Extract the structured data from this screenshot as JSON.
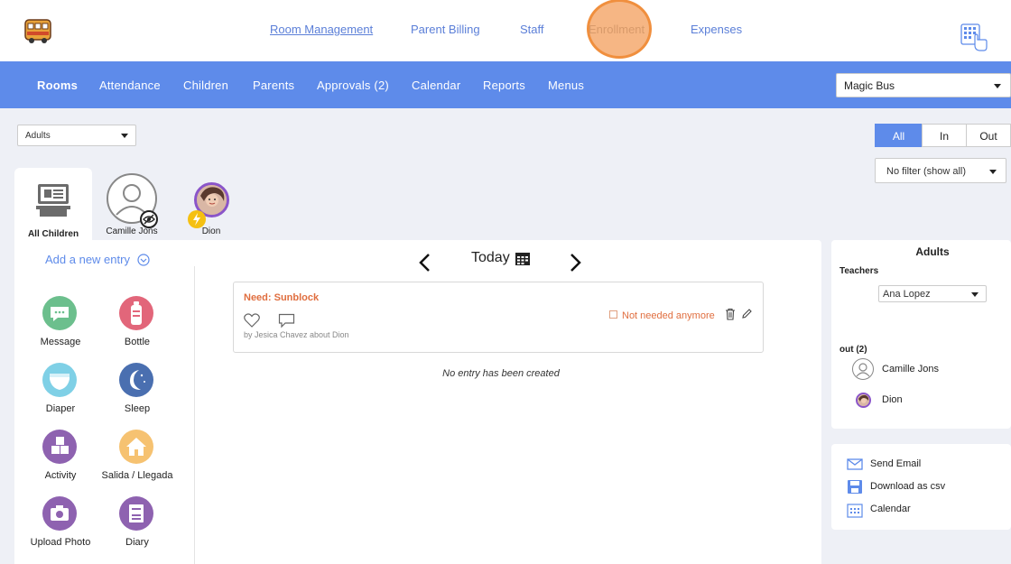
{
  "topnav": {
    "links": [
      "Room Management",
      "Parent Billing",
      "Staff",
      "Enrollment",
      "Expenses"
    ]
  },
  "mainnav": {
    "items": [
      "Rooms",
      "Attendance",
      "Children",
      "Parents",
      "Approvals (2)",
      "Calendar",
      "Reports",
      "Menus"
    ],
    "school": "Magic Bus"
  },
  "filters": {
    "group": "Adults",
    "segments": [
      "All",
      "In",
      "Out"
    ],
    "active_segment": "All",
    "filter": "No filter (show all)"
  },
  "children_tabs": {
    "all_label": "All Children",
    "kids": [
      "Camille Jons",
      "Dion"
    ]
  },
  "activities": {
    "add_label": "Add a new entry",
    "items": [
      "Message",
      "Bottle",
      "Diaper",
      "Sleep",
      "Activity",
      "Salida / Llegada",
      "Upload Photo",
      "Diary"
    ]
  },
  "feed": {
    "date_label": "Today",
    "entry": {
      "title": "Need: Sunblock",
      "byline": "by Jesica Chavez about Dion",
      "status": "Not needed anymore"
    },
    "empty_text": "No entry has been created"
  },
  "right_panel": {
    "title": "Adults",
    "teachers_label": "Teachers",
    "teacher": "Ana Lopez",
    "out_label": "out (2)",
    "out_people": [
      "Camille Jons",
      "Dion"
    ]
  },
  "actions": {
    "items": [
      "Send Email",
      "Download as csv",
      "Calendar"
    ]
  },
  "colors": {
    "accent": "#5e8bea",
    "alert": "#e06e3f",
    "highlight": "#f6b37e"
  }
}
